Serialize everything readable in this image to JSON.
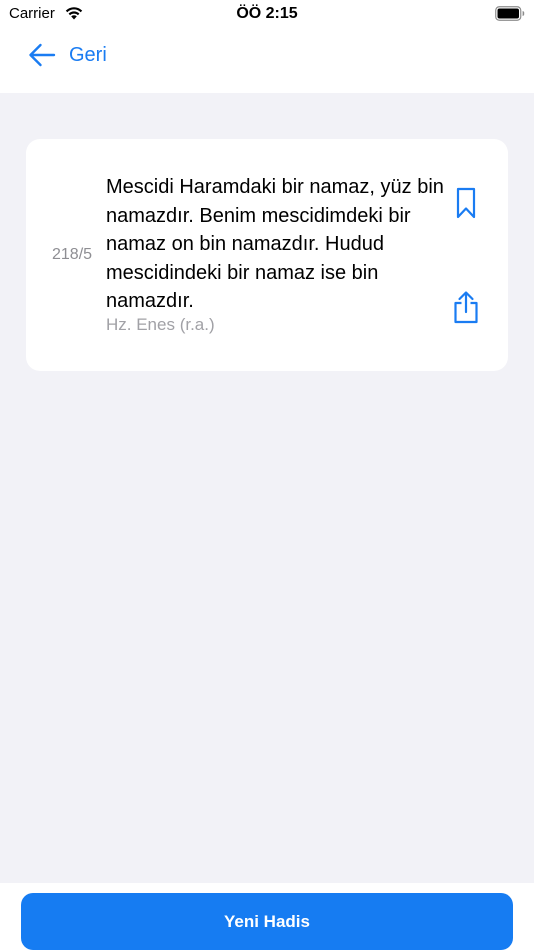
{
  "status_bar": {
    "carrier": "Carrier",
    "time": "ÖÖ 2:15",
    "icons": [
      "wifi-icon",
      "battery-icon"
    ]
  },
  "nav": {
    "back_label": "Geri",
    "back_icon": "arrow-left-icon"
  },
  "hadith": {
    "number": "218/5",
    "text": "Mescidi Haramdaki bir namaz, yüz bin namazdır. Benim mescidimdeki bir namaz on bin namazdır. Hudud mescidindeki bir namaz ise bin namazdır.",
    "source": "Hz. Enes (r.a.)",
    "actions": [
      "bookmark-icon",
      "share-icon"
    ]
  },
  "footer": {
    "new_button_label": "Yeni Hadis"
  },
  "colors": {
    "accent": "#1a7cf2",
    "background": "#f2f2f7",
    "card": "#ffffff",
    "secondary_text": "#8e8e93"
  }
}
